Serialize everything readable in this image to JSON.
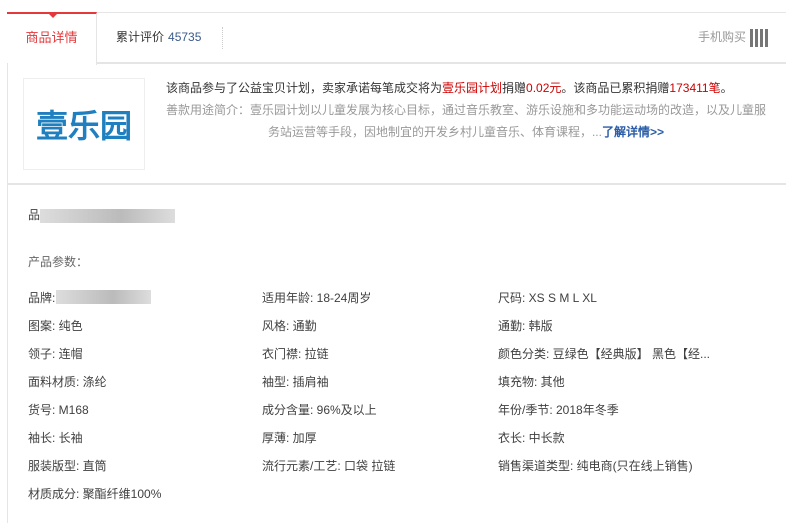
{
  "tabs": {
    "detail": "商品详情",
    "reviews_label": "累计评价",
    "reviews_count": "45735",
    "mobile": "手机购买"
  },
  "charity": {
    "logo_text": "壹乐园",
    "line1_a": "该商品参与了公益宝贝计划，卖家承诺每笔成交将为",
    "line1_plan": "壹乐园计划",
    "line1_b": "捐赠",
    "line1_amount": "0.02元",
    "line1_c": "。该商品已累积捐赠",
    "line1_count": "173411笔",
    "line1_d": "。",
    "line2": "善款用途简介：壹乐园计划以儿童发展为核心目标，通过音乐教室、游乐设施和多功能运动场的改造，以及儿童服务站运营等手段，因地制宜的开发乡村儿童音乐、体育课程，...",
    "more": "了解详情>>"
  },
  "brand_label": "品",
  "params_title": "产品参数：",
  "params": [
    "品牌:",
    "适用年龄: 18-24周岁",
    "尺码: XS S M L XL",
    "图案: 纯色",
    "风格: 通勤",
    "通勤: 韩版",
    "领子: 连帽",
    "衣门襟: 拉链",
    "颜色分类: 豆绿色【经典版】 黑色【经...",
    "面料材质: 涤纶",
    "袖型: 插肩袖",
    "填充物: 其他",
    "货号: M168",
    "成分含量: 96%及以上",
    "年份/季节: 2018年冬季",
    "袖长: 长袖",
    "厚薄: 加厚",
    "衣长: 中长款",
    "服装版型: 直筒",
    "流行元素/工艺: 口袋 拉链",
    "销售渠道类型: 纯电商(只在线上销售)",
    "材质成分: 聚酯纤维100%"
  ]
}
